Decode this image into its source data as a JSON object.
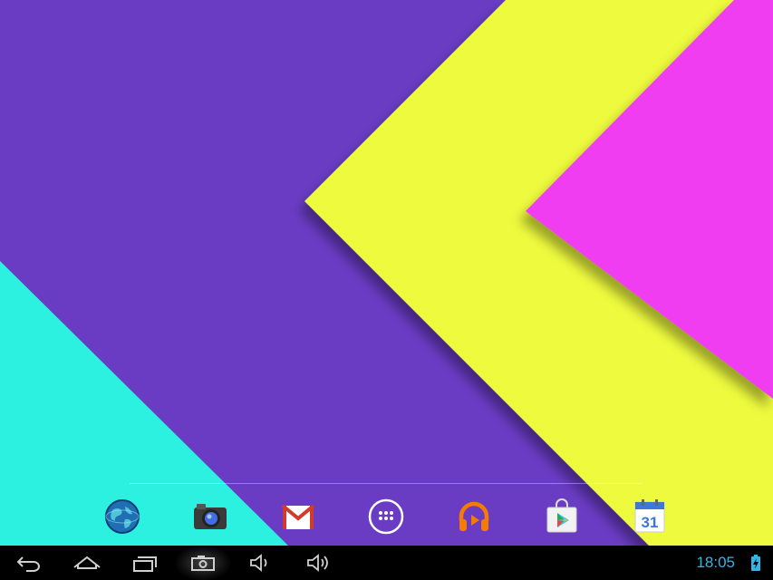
{
  "wallpaper": {
    "colors": {
      "purple": "#6a3cc4",
      "cyan": "#2cf0e0",
      "yellow": "#edfa3c",
      "magenta": "#f03cf2"
    }
  },
  "dock": {
    "items": [
      {
        "id": "browser",
        "icon": "globe-icon"
      },
      {
        "id": "camera",
        "icon": "camera-icon"
      },
      {
        "id": "gmail",
        "icon": "gmail-icon"
      },
      {
        "id": "app-drawer",
        "icon": "apps-grid-icon"
      },
      {
        "id": "play-music",
        "icon": "headphones-icon"
      },
      {
        "id": "play-store",
        "icon": "play-store-icon"
      },
      {
        "id": "calendar",
        "icon": "calendar-icon",
        "label": "31"
      }
    ]
  },
  "navbar": {
    "buttons": [
      "back-icon",
      "home-icon",
      "recents-icon",
      "screenshot-icon",
      "volume-down-icon",
      "volume-up-icon"
    ],
    "clock": "18:05",
    "accent": "#33b5e5"
  }
}
